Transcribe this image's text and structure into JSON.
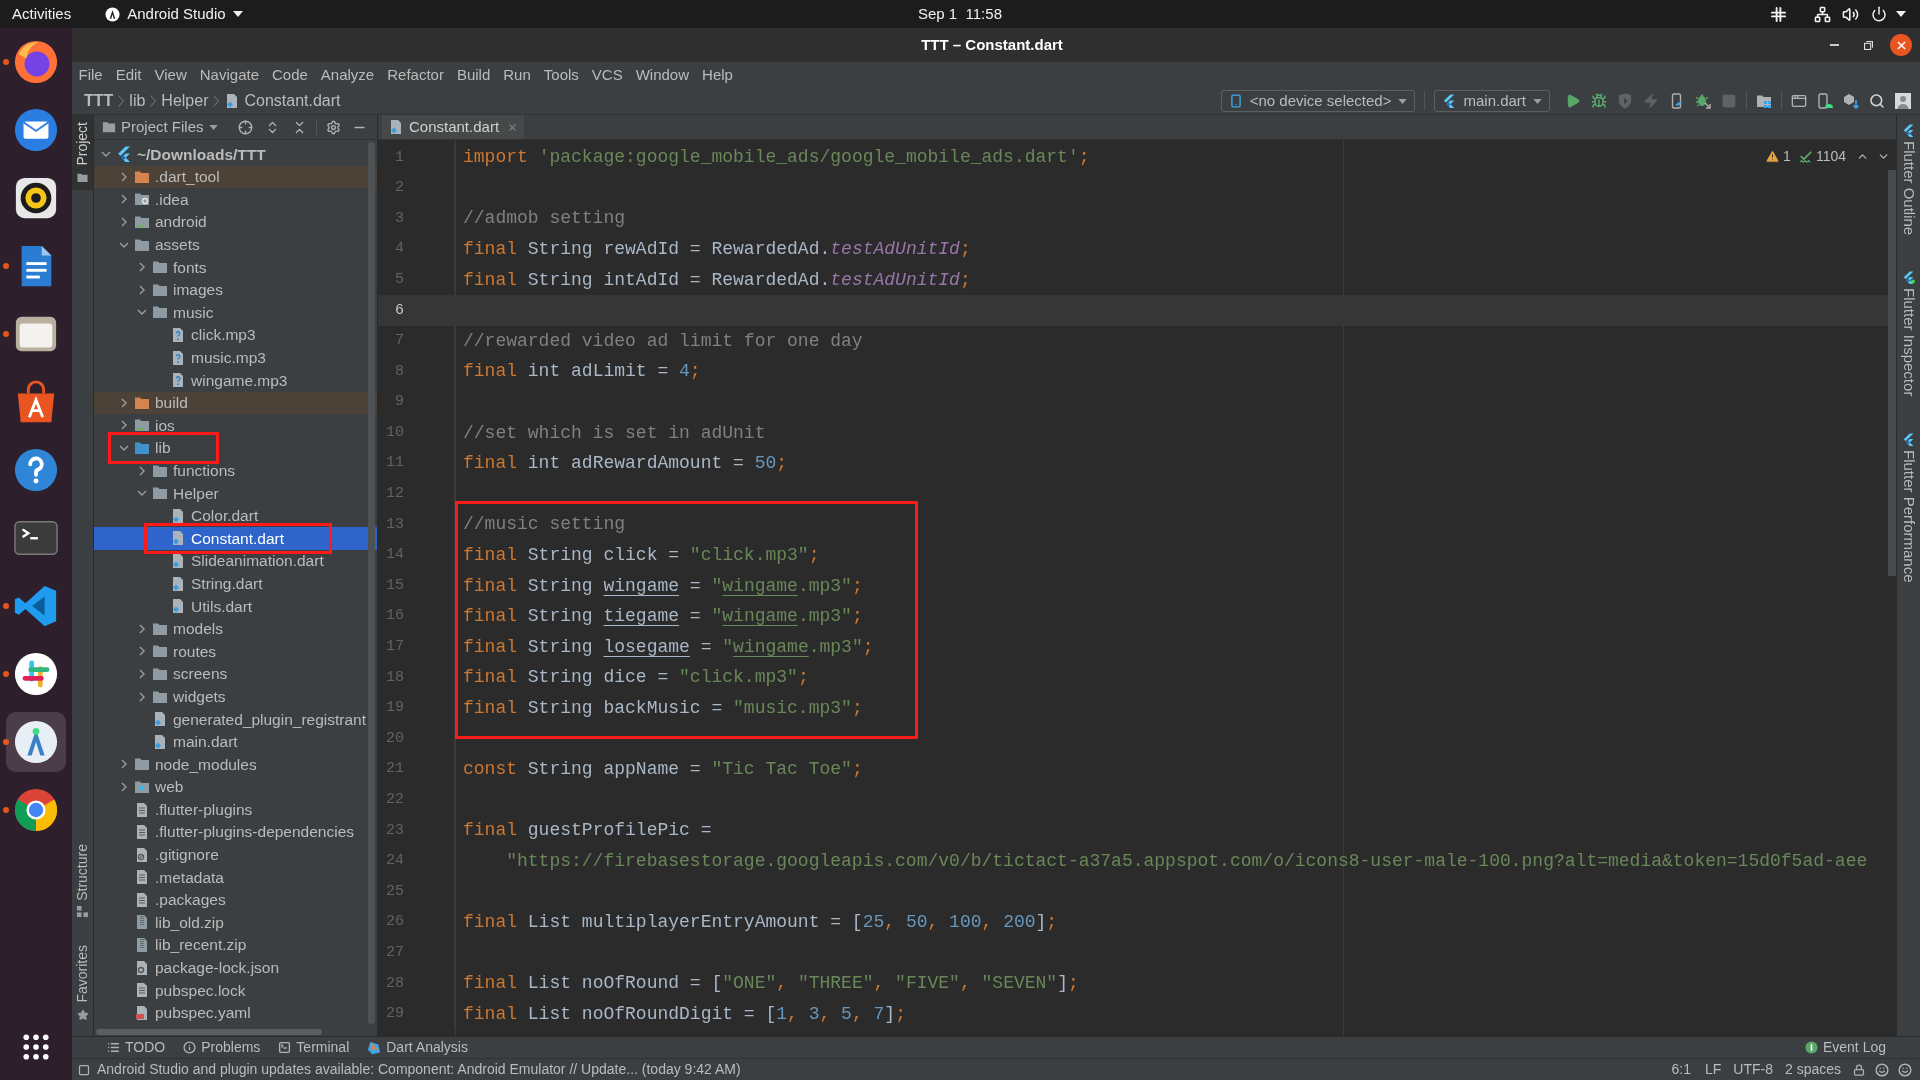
{
  "top_bar": {
    "activities": "Activities",
    "app_menu": "Android Studio",
    "clock": "Sep 1  11:58"
  },
  "dock": {
    "apps": [
      {
        "kind": "browser",
        "running": true,
        "selected": false
      },
      {
        "kind": "mail",
        "running": false,
        "selected": false
      },
      {
        "kind": "music",
        "running": false,
        "selected": false
      },
      {
        "kind": "document",
        "running": true,
        "selected": false
      },
      {
        "kind": "files",
        "running": true,
        "selected": false
      },
      {
        "kind": "store",
        "running": false,
        "selected": false
      },
      {
        "kind": "help",
        "running": false,
        "selected": false
      },
      {
        "kind": "terminal",
        "running": false,
        "selected": false
      },
      {
        "kind": "editor",
        "running": true,
        "selected": false
      },
      {
        "kind": "chat",
        "running": true,
        "selected": false
      },
      {
        "kind": "ide",
        "running": true,
        "selected": true
      },
      {
        "kind": "web",
        "running": true,
        "selected": false
      }
    ]
  },
  "window": {
    "title": "TTT – Constant.dart"
  },
  "menu": [
    "File",
    "Edit",
    "View",
    "Navigate",
    "Code",
    "Analyze",
    "Refactor",
    "Build",
    "Run",
    "Tools",
    "VCS",
    "Window",
    "Help"
  ],
  "breadcrumb": [
    {
      "label": "TTT",
      "kind": "project"
    },
    {
      "label": "lib",
      "kind": "folder"
    },
    {
      "label": "Helper",
      "kind": "folder"
    },
    {
      "label": "Constant.dart",
      "kind": "dart_file"
    }
  ],
  "toolbar": {
    "device_selector": "<no device selected>",
    "run_config": "main.dart",
    "action_groups": [
      {
        "actions": [
          {
            "kind": "run",
            "disabled": false
          },
          {
            "kind": "debug",
            "disabled": false
          },
          {
            "kind": "profile",
            "disabled": true
          },
          {
            "kind": "hot_reload",
            "disabled": true
          },
          {
            "kind": "device",
            "disabled": false
          },
          {
            "kind": "attach",
            "disabled": false
          },
          {
            "kind": "stop",
            "disabled": true
          }
        ]
      },
      {
        "actions": [
          {
            "kind": "project_structure",
            "disabled": false
          }
        ]
      },
      {
        "actions": [
          {
            "kind": "window",
            "disabled": false
          },
          {
            "kind": "avd",
            "disabled": false
          },
          {
            "kind": "sdk",
            "disabled": false
          },
          {
            "kind": "search",
            "disabled": false
          },
          {
            "kind": "account",
            "disabled": false
          }
        ]
      }
    ]
  },
  "left_tool_strip": {
    "top": [
      {
        "label": "Project",
        "kind": "project",
        "selected": true
      }
    ],
    "bottom": [
      {
        "label": "Structure",
        "kind": "structure",
        "selected": false
      },
      {
        "label": "Favorites",
        "kind": "favorites",
        "selected": false
      }
    ]
  },
  "project_panel": {
    "view": "Project Files",
    "tree": [
      {
        "label": "~/Downloads/TTT",
        "kind": "project",
        "expanded": true,
        "selected": false,
        "boxed": false,
        "children": [
          {
            "label": ".dart_tool",
            "kind": "excluded_folder",
            "expanded": false,
            "selected": false,
            "boxed": false
          },
          {
            "label": ".idea",
            "kind": "config_folder",
            "expanded": false,
            "selected": false,
            "boxed": false
          },
          {
            "label": "android",
            "kind": "module_folder",
            "expanded": false,
            "selected": false,
            "boxed": false
          },
          {
            "label": "assets",
            "kind": "folder",
            "expanded": true,
            "selected": false,
            "boxed": false,
            "children": [
              {
                "label": "fonts",
                "kind": "folder",
                "expanded": false,
                "selected": false,
                "boxed": false
              },
              {
                "label": "images",
                "kind": "folder",
                "expanded": false,
                "selected": false,
                "boxed": false
              },
              {
                "label": "music",
                "kind": "folder",
                "expanded": true,
                "selected": false,
                "boxed": false,
                "children": [
                  {
                    "label": "click.mp3",
                    "kind": "unknown_file",
                    "selected": false,
                    "boxed": false
                  },
                  {
                    "label": "music.mp3",
                    "kind": "unknown_file",
                    "selected": false,
                    "boxed": false
                  },
                  {
                    "label": "wingame.mp3",
                    "kind": "unknown_file",
                    "selected": false,
                    "boxed": false
                  }
                ]
              }
            ]
          },
          {
            "label": "build",
            "kind": "excluded_folder",
            "expanded": false,
            "selected": false,
            "boxed": false
          },
          {
            "label": "ios",
            "kind": "module_folder",
            "expanded": false,
            "selected": false,
            "boxed": false
          },
          {
            "label": "lib",
            "kind": "source_folder",
            "expanded": true,
            "selected": false,
            "boxed": true,
            "children": [
              {
                "label": "functions",
                "kind": "folder",
                "expanded": false,
                "selected": false,
                "boxed": false
              },
              {
                "label": "Helper",
                "kind": "folder",
                "expanded": true,
                "selected": false,
                "boxed": false,
                "children": [
                  {
                    "label": "Color.dart",
                    "kind": "dart_file",
                    "selected": false,
                    "boxed": false
                  },
                  {
                    "label": "Constant.dart",
                    "kind": "dart_file",
                    "selected": true,
                    "boxed": true
                  },
                  {
                    "label": "Slideanimation.dart",
                    "kind": "dart_file",
                    "selected": false,
                    "boxed": false
                  },
                  {
                    "label": "String.dart",
                    "kind": "dart_file",
                    "selected": false,
                    "boxed": false
                  },
                  {
                    "label": "Utils.dart",
                    "kind": "dart_file",
                    "selected": false,
                    "boxed": false
                  }
                ]
              },
              {
                "label": "models",
                "kind": "folder",
                "expanded": false,
                "selected": false,
                "boxed": false
              },
              {
                "label": "routes",
                "kind": "folder",
                "expanded": false,
                "selected": false,
                "boxed": false
              },
              {
                "label": "screens",
                "kind": "folder",
                "expanded": false,
                "selected": false,
                "boxed": false
              },
              {
                "label": "widgets",
                "kind": "folder",
                "expanded": false,
                "selected": false,
                "boxed": false
              },
              {
                "label": "generated_plugin_registrant",
                "kind": "dart_file",
                "selected": false,
                "boxed": false
              },
              {
                "label": "main.dart",
                "kind": "dart_file",
                "selected": false,
                "boxed": false
              }
            ]
          },
          {
            "label": "node_modules",
            "kind": "folder",
            "expanded": false,
            "selected": false,
            "boxed": false
          },
          {
            "label": "web",
            "kind": "web_folder",
            "expanded": false,
            "selected": false,
            "boxed": false
          },
          {
            "label": ".flutter-plugins",
            "kind": "text_file",
            "selected": false,
            "boxed": false
          },
          {
            "label": ".flutter-plugins-dependencies",
            "kind": "text_file",
            "selected": false,
            "boxed": false
          },
          {
            "label": ".gitignore",
            "kind": "ignore_file",
            "selected": false,
            "boxed": false
          },
          {
            "label": ".metadata",
            "kind": "text_file",
            "selected": false,
            "boxed": false
          },
          {
            "label": ".packages",
            "kind": "text_file",
            "selected": false,
            "boxed": false
          },
          {
            "label": "lib_old.zip",
            "kind": "archive_file",
            "selected": false,
            "boxed": false
          },
          {
            "label": "lib_recent.zip",
            "kind": "archive_file",
            "selected": false,
            "boxed": false
          },
          {
            "label": "package-lock.json",
            "kind": "json_file",
            "selected": false,
            "boxed": false
          },
          {
            "label": "pubspec.lock",
            "kind": "text_file",
            "selected": false,
            "boxed": false
          },
          {
            "label": "pubspec.yaml",
            "kind": "yaml_file",
            "selected": false,
            "boxed": false
          }
        ]
      }
    ]
  },
  "editor": {
    "tabs": [
      {
        "label": "Constant.dart",
        "selected": true
      }
    ],
    "inspections": {
      "warnings": "1",
      "typos": "1104"
    },
    "blocks": [
      {
        "boxed": false,
        "lines": [
          {
            "number": "1",
            "current": false,
            "tokens": [
              {
                "kind": "keyword",
                "text": "import "
              },
              {
                "kind": "string",
                "text": "'package:google_mobile_ads/google_mobile_ads.dart'"
              },
              {
                "kind": "punct",
                "text": ";"
              }
            ]
          },
          {
            "number": "2",
            "current": false
          },
          {
            "number": "3",
            "current": false,
            "tokens": [
              {
                "kind": "comment",
                "text": "//admob setting"
              }
            ]
          },
          {
            "number": "4",
            "current": false,
            "tokens": [
              {
                "kind": "keyword",
                "text": "final"
              },
              {
                "kind": "plain",
                "text": " String rewAdId = RewardedAd."
              },
              {
                "kind": "field",
                "text": "testAdUnitId"
              },
              {
                "kind": "punct",
                "text": ";"
              }
            ]
          },
          {
            "number": "5",
            "current": false,
            "tokens": [
              {
                "kind": "keyword",
                "text": "final"
              },
              {
                "kind": "plain",
                "text": " String intAdId = RewardedAd."
              },
              {
                "kind": "field",
                "text": "testAdUnitId"
              },
              {
                "kind": "punct",
                "text": ";"
              }
            ]
          },
          {
            "number": "6",
            "current": true
          },
          {
            "number": "7",
            "current": false,
            "tokens": [
              {
                "kind": "comment",
                "text": "//rewarded video ad limit for one day"
              }
            ]
          },
          {
            "number": "8",
            "current": false,
            "tokens": [
              {
                "kind": "keyword",
                "text": "final"
              },
              {
                "kind": "plain",
                "text": " int adLimit = "
              },
              {
                "kind": "number",
                "text": "4"
              },
              {
                "kind": "punct",
                "text": ";"
              }
            ]
          },
          {
            "number": "9",
            "current": false
          },
          {
            "number": "10",
            "current": false,
            "tokens": [
              {
                "kind": "comment",
                "text": "//set which is set in adUnit"
              }
            ]
          },
          {
            "number": "11",
            "current": false,
            "tokens": [
              {
                "kind": "keyword",
                "text": "final"
              },
              {
                "kind": "plain",
                "text": " int adRewardAmount = "
              },
              {
                "kind": "number",
                "text": "50"
              },
              {
                "kind": "punct",
                "text": ";"
              }
            ]
          },
          {
            "number": "12",
            "current": false
          }
        ]
      },
      {
        "boxed": true,
        "lines": [
          {
            "number": "13",
            "current": false,
            "tokens": [
              {
                "kind": "comment",
                "text": "//music setting"
              }
            ]
          },
          {
            "number": "14",
            "current": false,
            "tokens": [
              {
                "kind": "keyword",
                "text": "final"
              },
              {
                "kind": "plain",
                "text": " String click = "
              },
              {
                "kind": "string",
                "text": "\"click.mp3\""
              },
              {
                "kind": "punct",
                "text": ";"
              }
            ]
          },
          {
            "number": "15",
            "current": false,
            "tokens": [
              {
                "kind": "keyword",
                "text": "final"
              },
              {
                "kind": "plain",
                "text": " String "
              },
              {
                "kind": "typo",
                "text": "wingame"
              },
              {
                "kind": "plain",
                "text": " = "
              },
              {
                "kind": "string",
                "text": "\""
              },
              {
                "kind": "typo_string",
                "text": "wingame"
              },
              {
                "kind": "string",
                "text": ".mp3\""
              },
              {
                "kind": "punct",
                "text": ";"
              }
            ]
          },
          {
            "number": "16",
            "current": false,
            "tokens": [
              {
                "kind": "keyword",
                "text": "final"
              },
              {
                "kind": "plain",
                "text": " String "
              },
              {
                "kind": "typo",
                "text": "tiegame"
              },
              {
                "kind": "plain",
                "text": " = "
              },
              {
                "kind": "string",
                "text": "\""
              },
              {
                "kind": "typo_string",
                "text": "wingame"
              },
              {
                "kind": "string",
                "text": ".mp3\""
              },
              {
                "kind": "punct",
                "text": ";"
              }
            ]
          },
          {
            "number": "17",
            "current": false,
            "tokens": [
              {
                "kind": "keyword",
                "text": "final"
              },
              {
                "kind": "plain",
                "text": " String "
              },
              {
                "kind": "typo",
                "text": "losegame"
              },
              {
                "kind": "plain",
                "text": " = "
              },
              {
                "kind": "string",
                "text": "\""
              },
              {
                "kind": "typo_string",
                "text": "wingame"
              },
              {
                "kind": "string",
                "text": ".mp3\""
              },
              {
                "kind": "punct",
                "text": ";"
              }
            ]
          },
          {
            "number": "18",
            "current": false,
            "tokens": [
              {
                "kind": "keyword",
                "text": "final"
              },
              {
                "kind": "plain",
                "text": " String dice = "
              },
              {
                "kind": "string",
                "text": "\"click.mp3\""
              },
              {
                "kind": "punct",
                "text": ";"
              }
            ]
          },
          {
            "number": "19",
            "current": false,
            "tokens": [
              {
                "kind": "keyword",
                "text": "final"
              },
              {
                "kind": "plain",
                "text": " String backMusic = "
              },
              {
                "kind": "string",
                "text": "\"music.mp3\""
              },
              {
                "kind": "punct",
                "text": ";"
              }
            ]
          }
        ]
      },
      {
        "boxed": false,
        "lines": [
          {
            "number": "20",
            "current": false
          },
          {
            "number": "21",
            "current": false,
            "tokens": [
              {
                "kind": "keyword",
                "text": "const"
              },
              {
                "kind": "plain",
                "text": " String appName = "
              },
              {
                "kind": "string",
                "text": "\"Tic Tac Toe\""
              },
              {
                "kind": "punct",
                "text": ";"
              }
            ]
          },
          {
            "number": "22",
            "current": false
          },
          {
            "number": "23",
            "current": false,
            "tokens": [
              {
                "kind": "keyword",
                "text": "final"
              },
              {
                "kind": "plain",
                "text": " guestProfilePic ="
              }
            ]
          },
          {
            "number": "24",
            "current": false,
            "tokens": [
              {
                "kind": "string",
                "text": "    \"https://firebasestorage.googleapis.com/v0/b/tictact-a37a5.appspot.com/o/icons8-user-male-100.png?alt=media&token=15d0f5ad-aee"
              }
            ]
          },
          {
            "number": "25",
            "current": false
          },
          {
            "number": "26",
            "current": false,
            "tokens": [
              {
                "kind": "keyword",
                "text": "final"
              },
              {
                "kind": "plain",
                "text": " List multiplayerEntryAmount = ["
              },
              {
                "kind": "number",
                "text": "25"
              },
              {
                "kind": "punct",
                "text": ", "
              },
              {
                "kind": "number",
                "text": "50"
              },
              {
                "kind": "punct",
                "text": ", "
              },
              {
                "kind": "number",
                "text": "100"
              },
              {
                "kind": "punct",
                "text": ", "
              },
              {
                "kind": "number",
                "text": "200"
              },
              {
                "kind": "plain",
                "text": "]"
              },
              {
                "kind": "punct",
                "text": ";"
              }
            ]
          },
          {
            "number": "27",
            "current": false
          },
          {
            "number": "28",
            "current": false,
            "tokens": [
              {
                "kind": "keyword",
                "text": "final"
              },
              {
                "kind": "plain",
                "text": " List noOfRound = ["
              },
              {
                "kind": "string",
                "text": "\"ONE\""
              },
              {
                "kind": "punct",
                "text": ", "
              },
              {
                "kind": "string",
                "text": "\"THREE\""
              },
              {
                "kind": "punct",
                "text": ", "
              },
              {
                "kind": "string",
                "text": "\"FIVE\""
              },
              {
                "kind": "punct",
                "text": ", "
              },
              {
                "kind": "string",
                "text": "\"SEVEN\""
              },
              {
                "kind": "plain",
                "text": "]"
              },
              {
                "kind": "punct",
                "text": ";"
              }
            ]
          },
          {
            "number": "29",
            "current": false,
            "tokens": [
              {
                "kind": "keyword",
                "text": "final"
              },
              {
                "kind": "plain",
                "text": " List noOfRoundDigit = ["
              },
              {
                "kind": "number",
                "text": "1"
              },
              {
                "kind": "punct",
                "text": ", "
              },
              {
                "kind": "number",
                "text": "3"
              },
              {
                "kind": "punct",
                "text": ", "
              },
              {
                "kind": "number",
                "text": "5"
              },
              {
                "kind": "punct",
                "text": ", "
              },
              {
                "kind": "number",
                "text": "7"
              },
              {
                "kind": "plain",
                "text": "]"
              },
              {
                "kind": "punct",
                "text": ";"
              }
            ]
          }
        ]
      }
    ]
  },
  "right_tool_strip": [
    {
      "label": "Flutter Outline",
      "active": false
    },
    {
      "label": "Flutter Inspector",
      "active": true
    },
    {
      "label": "Flutter Performance",
      "active": false
    }
  ],
  "bottom_tools": {
    "left": [
      {
        "label": "TODO",
        "kind": "todo"
      },
      {
        "label": "Problems",
        "kind": "problems"
      },
      {
        "label": "Terminal",
        "kind": "terminal"
      },
      {
        "label": "Dart Analysis",
        "kind": "dart_analysis"
      }
    ],
    "right": [
      {
        "label": "Event Log",
        "kind": "event_log"
      }
    ]
  },
  "status_bar": {
    "message": "Android Studio and plugin updates available: Component: Android Emulator // Update... (today 9:42 AM)",
    "position": "6:1",
    "line_separator": "LF",
    "encoding": "UTF-8",
    "indent": "2 spaces"
  }
}
